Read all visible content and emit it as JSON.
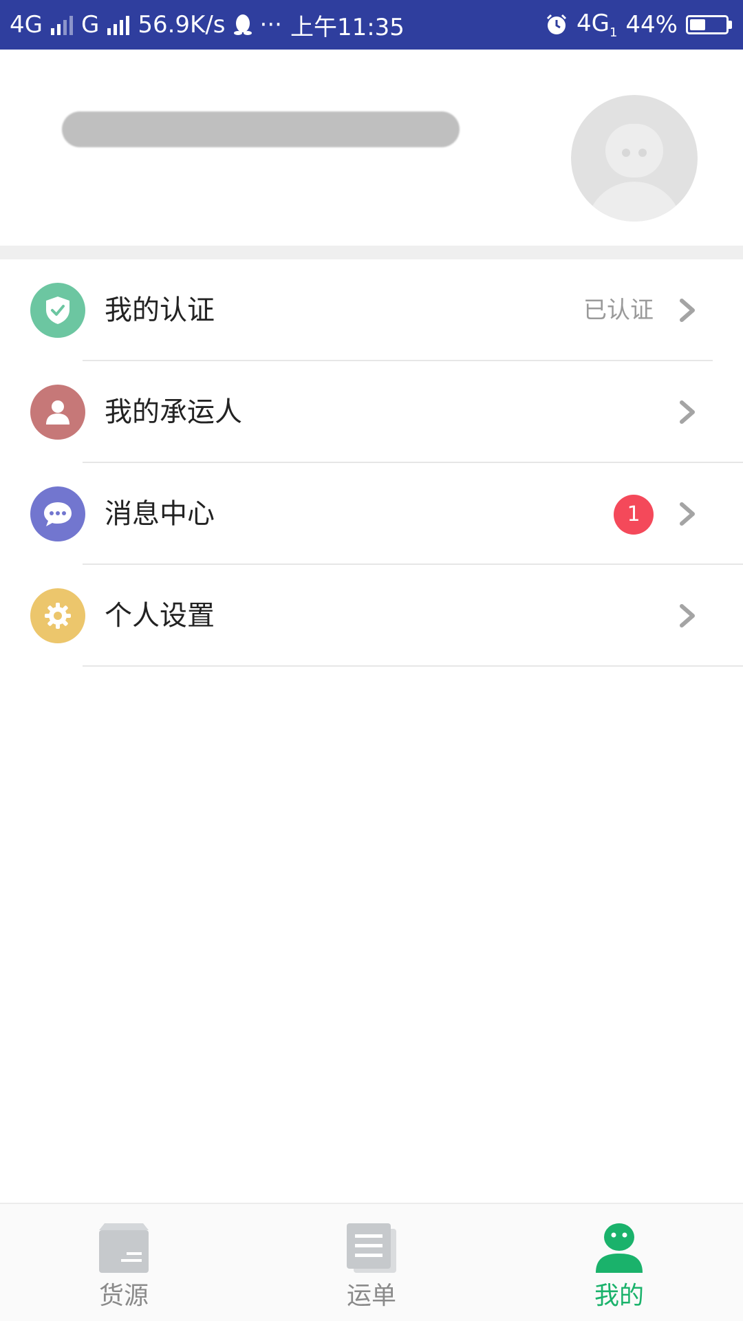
{
  "status_bar": {
    "network1": "4G",
    "network2": "G",
    "speed": "56.9K/s",
    "more": "···",
    "time": "上午11:35",
    "network3": "4G",
    "network3_sub": "1",
    "battery": "44%",
    "battery_level": 0.44,
    "background_color": "#2f3e9e"
  },
  "profile": {
    "avatar_icon": "default-user-avatar"
  },
  "menu": {
    "items": [
      {
        "label": "我的认证",
        "status": "已认证",
        "icon": "shield-check-icon",
        "icon_color": "#6cc6a1"
      },
      {
        "label": "我的承运人",
        "icon": "user-icon",
        "icon_color": "#c67878"
      },
      {
        "label": "消息中心",
        "badge": "1",
        "icon": "chat-bubble-icon",
        "icon_color": "#7276cf"
      },
      {
        "label": "个人设置",
        "icon": "gear-icon",
        "icon_color": "#ecc66c"
      }
    ]
  },
  "tabbar": {
    "tabs": [
      {
        "label": "货源",
        "icon": "box-icon",
        "active": false
      },
      {
        "label": "运单",
        "icon": "document-icon",
        "active": false
      },
      {
        "label": "我的",
        "icon": "person-icon",
        "active": true
      }
    ],
    "active_color": "#1ab26b",
    "inactive_color": "#c6c9cc"
  }
}
